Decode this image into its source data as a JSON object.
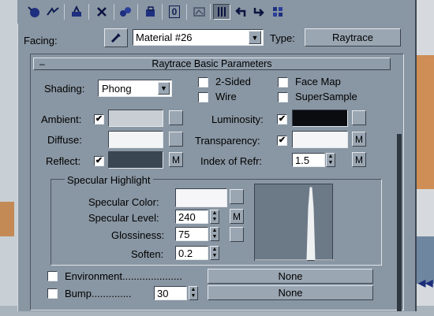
{
  "toolbar": {
    "icons": [
      "get-material-icon",
      "put-to-scene-icon",
      "assign-material-icon",
      "reset-icon",
      "make-copy-icon",
      "make-unique-icon",
      "put-to-library-icon",
      "material-effects-channel-icon",
      "show-map-icon",
      "show-end-result-icon",
      "go-to-parent-icon",
      "go-forward-icon",
      "select-by-material-icon"
    ],
    "channel_label": "0"
  },
  "facing": {
    "label": "Facing:",
    "material_name": "Material #26",
    "type_label": "Type:",
    "type_value": "Raytrace"
  },
  "rollout": {
    "collapse_symbol": "–",
    "title": "Raytrace Basic Parameters"
  },
  "shading": {
    "label": "Shading:",
    "value": "Phong",
    "options": [
      {
        "label": "2-Sided",
        "checked": false
      },
      {
        "label": "Wire",
        "checked": false
      },
      {
        "label": "Face Map",
        "checked": false
      },
      {
        "label": "SuperSample",
        "checked": false
      }
    ]
  },
  "colors": {
    "ambient": {
      "label": "Ambient:",
      "checked": true,
      "swatch": "#c9ced4"
    },
    "diffuse": {
      "label": "Diffuse:",
      "swatch": "#f3f4f6"
    },
    "reflect": {
      "label": "Reflect:",
      "checked": true,
      "swatch": "#3a4753",
      "map_label": "M"
    },
    "luminosity": {
      "label": "Luminosity:",
      "checked": true,
      "swatch": "#0b0c10"
    },
    "transparency": {
      "label": "Transparency:",
      "checked": true,
      "swatch": "#f5f5f7",
      "map_label": "M"
    },
    "index_of_refr": {
      "label": "Index of Refr:",
      "value": "1.5",
      "map_label": "M"
    }
  },
  "specular": {
    "group_title": "Specular Highlight",
    "specular_color": {
      "label": "Specular Color:",
      "swatch": "#f6f6f8"
    },
    "specular_level": {
      "label": "Specular Level:",
      "value": "240",
      "map_label": "M"
    },
    "glossiness": {
      "label": "Glossiness:",
      "value": "75"
    },
    "soften": {
      "label": "Soften:",
      "value": "0.2"
    }
  },
  "environment": {
    "label": "Environment.....................",
    "checked": false,
    "map": "None"
  },
  "bump": {
    "label": "Bump..............",
    "checked": false,
    "amount": "30",
    "map": "None"
  },
  "backdrop": {
    "right_arrows": "◀◀"
  }
}
